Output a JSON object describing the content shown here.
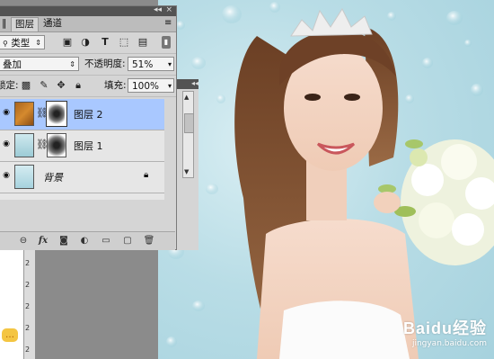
{
  "panel": {
    "tabs": [
      {
        "label": "图层",
        "active": true
      },
      {
        "label": "通道",
        "active": false
      }
    ],
    "filter": {
      "value": "类型",
      "icon_names": [
        "image-filter-icon",
        "adjustment-filter-icon",
        "text-filter-icon",
        "shape-filter-icon",
        "smart-object-filter-icon",
        "filter-toggle-icon"
      ]
    },
    "blend_mode": {
      "value": "叠加"
    },
    "opacity": {
      "label": "不透明度:",
      "value": "51%"
    },
    "lock": {
      "label": "锁定:"
    },
    "fill": {
      "label": "填充:",
      "value": "100%"
    },
    "layers": [
      {
        "name": "图层 2",
        "selected": true,
        "visible": true,
        "has_mask": true
      },
      {
        "name": "图层 1",
        "selected": false,
        "visible": true,
        "has_mask": true
      },
      {
        "name": "背景",
        "selected": false,
        "visible": true,
        "locked": true
      }
    ],
    "bottom_icons": [
      "link-layers-icon",
      "fx-icon",
      "add-mask-icon",
      "adjustment-layer-icon",
      "new-group-icon",
      "new-layer-icon",
      "delete-layer-icon"
    ],
    "fx_label": "fx"
  },
  "ruler": {
    "ticks": [
      "2",
      "2",
      "2",
      "2",
      "2"
    ]
  },
  "watermark": {
    "logo": "Baidu经验",
    "url": "jingyan.baidu.com"
  },
  "colors": {
    "panel_bg": "#d5d5d5",
    "selected_layer": "#a9c8ff",
    "workspace": "#8b8b8b",
    "photo_bg": "#b9dde6"
  }
}
